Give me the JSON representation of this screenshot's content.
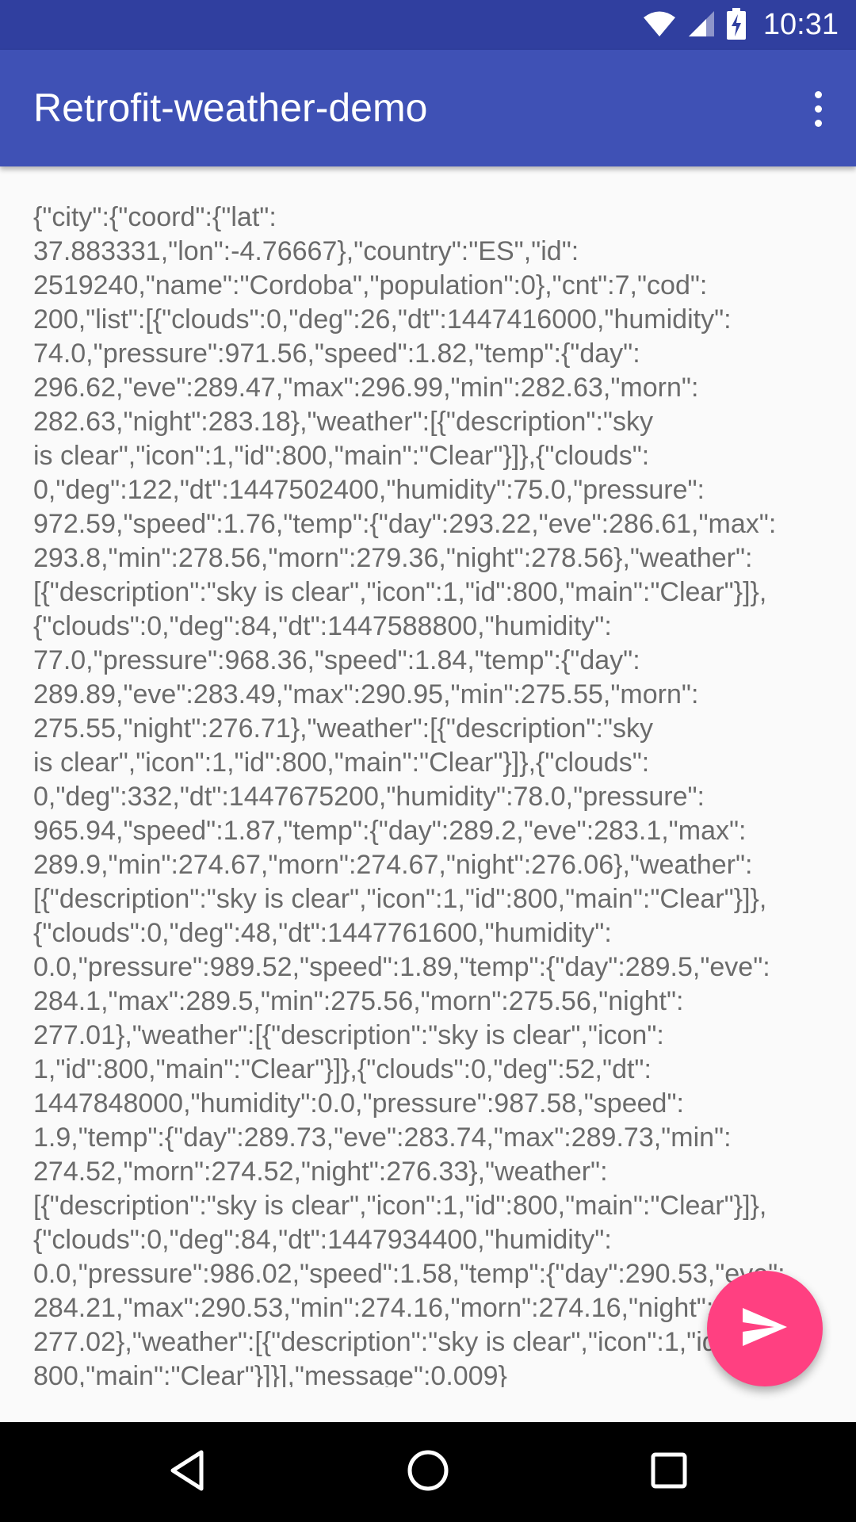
{
  "status_bar": {
    "time": "10:31",
    "icons": [
      "wifi-icon",
      "cell-signal-icon",
      "battery-charging-icon"
    ]
  },
  "app_bar": {
    "title": "Retrofit-weather-demo",
    "overflow_icon": "more-vert-icon"
  },
  "content": {
    "response_text": "{\"city\":{\"coord\":{\"lat\":\n37.883331,\"lon\":-4.76667},\"country\":\"ES\",\"id\":\n2519240,\"name\":\"Cordoba\",\"population\":0},\"cnt\":7,\"cod\":\n200,\"list\":[{\"clouds\":0,\"deg\":26,\"dt\":1447416000,\"humidity\":\n74.0,\"pressure\":971.56,\"speed\":1.82,\"temp\":{\"day\":\n296.62,\"eve\":289.47,\"max\":296.99,\"min\":282.63,\"morn\":\n282.63,\"night\":283.18},\"weather\":[{\"description\":\"sky\nis clear\",\"icon\":1,\"id\":800,\"main\":\"Clear\"}]},{\"clouds\":\n0,\"deg\":122,\"dt\":1447502400,\"humidity\":75.0,\"pressure\":\n972.59,\"speed\":1.76,\"temp\":{\"day\":293.22,\"eve\":286.61,\"max\":\n293.8,\"min\":278.56,\"morn\":279.36,\"night\":278.56},\"weather\":\n[{\"description\":\"sky is clear\",\"icon\":1,\"id\":800,\"main\":\"Clear\"}]},\n{\"clouds\":0,\"deg\":84,\"dt\":1447588800,\"humidity\":\n77.0,\"pressure\":968.36,\"speed\":1.84,\"temp\":{\"day\":\n289.89,\"eve\":283.49,\"max\":290.95,\"min\":275.55,\"morn\":\n275.55,\"night\":276.71},\"weather\":[{\"description\":\"sky\nis clear\",\"icon\":1,\"id\":800,\"main\":\"Clear\"}]},{\"clouds\":\n0,\"deg\":332,\"dt\":1447675200,\"humidity\":78.0,\"pressure\":\n965.94,\"speed\":1.87,\"temp\":{\"day\":289.2,\"eve\":283.1,\"max\":\n289.9,\"min\":274.67,\"morn\":274.67,\"night\":276.06},\"weather\":\n[{\"description\":\"sky is clear\",\"icon\":1,\"id\":800,\"main\":\"Clear\"}]},\n{\"clouds\":0,\"deg\":48,\"dt\":1447761600,\"humidity\":\n0.0,\"pressure\":989.52,\"speed\":1.89,\"temp\":{\"day\":289.5,\"eve\":\n284.1,\"max\":289.5,\"min\":275.56,\"morn\":275.56,\"night\":\n277.01},\"weather\":[{\"description\":\"sky is clear\",\"icon\":\n1,\"id\":800,\"main\":\"Clear\"}]},{\"clouds\":0,\"deg\":52,\"dt\":\n1447848000,\"humidity\":0.0,\"pressure\":987.58,\"speed\":\n1.9,\"temp\":{\"day\":289.73,\"eve\":283.74,\"max\":289.73,\"min\":\n274.52,\"morn\":274.52,\"night\":276.33},\"weather\":\n[{\"description\":\"sky is clear\",\"icon\":1,\"id\":800,\"main\":\"Clear\"}]},\n{\"clouds\":0,\"deg\":84,\"dt\":1447934400,\"humidity\":\n0.0,\"pressure\":986.02,\"speed\":1.58,\"temp\":{\"day\":290.53,\"eve\":\n284.21,\"max\":290.53,\"min\":274.16,\"morn\":274.16,\"night\":\n277.02},\"weather\":[{\"description\":\"sky is clear\",\"icon\":1,\"id\":\n800,\"main\":\"Clear\"}]}],\"message\":0.009}"
  },
  "fab": {
    "icon": "send-icon",
    "color": "#ff4081"
  },
  "nav_bar": {
    "buttons": [
      "back-icon",
      "home-icon",
      "recents-icon"
    ]
  },
  "colors": {
    "primary": "#3f51b5",
    "primary_dark": "#303f9f",
    "accent": "#ff4081",
    "text": "#6b6b6b",
    "background": "#fafafa"
  }
}
